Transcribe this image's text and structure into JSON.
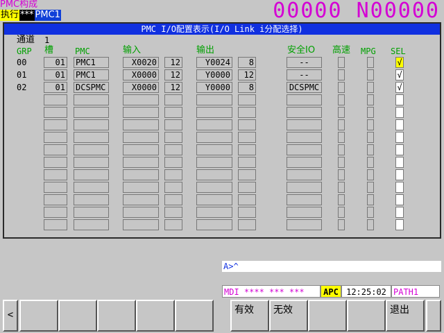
{
  "screen": {
    "title": "PMC构成"
  },
  "mode_line": {
    "mode": "执行",
    "stars": "***",
    "pmc": "PMC1"
  },
  "program": {
    "numbers": "00000 N00000"
  },
  "panel": {
    "title": "PMC I/O配置表示(I/O Link i分配选择)"
  },
  "channel": {
    "label": "通道",
    "value": "1"
  },
  "headers": {
    "grp": "GRP",
    "slot": "槽",
    "pmc": "PMC",
    "input": "输入",
    "output": "输出",
    "safety_io": "安全IO",
    "high_speed": "高速",
    "mpg": "MPG",
    "sel": "SEL"
  },
  "rows": [
    {
      "grp": "00",
      "slot": "01",
      "pmc": "PMC1",
      "in_addr": "X0020",
      "in_size": "12",
      "out_addr": "Y0024",
      "out_size": "8",
      "safety": "--",
      "sel": "√"
    },
    {
      "grp": "01",
      "slot": "01",
      "pmc": "PMC1",
      "in_addr": "X0000",
      "in_size": "12",
      "out_addr": "Y0000",
      "out_size": "12",
      "safety": "--",
      "sel": "√"
    },
    {
      "grp": "02",
      "slot": "01",
      "pmc": "DCSPMC",
      "in_addr": "X0000",
      "in_size": "12",
      "out_addr": "Y0000",
      "out_size": "8",
      "safety": "DCSPMC",
      "sel": "√"
    }
  ],
  "command_line": {
    "prompt": "A>^"
  },
  "status_bar": {
    "mode": "MDI **** *** ***",
    "apc": "APC",
    "time": "12:25:02",
    "path": "PATH1"
  },
  "softkeys": {
    "left_arrow": "<",
    "enable": "有效",
    "disable": "无效",
    "exit": "退出"
  }
}
